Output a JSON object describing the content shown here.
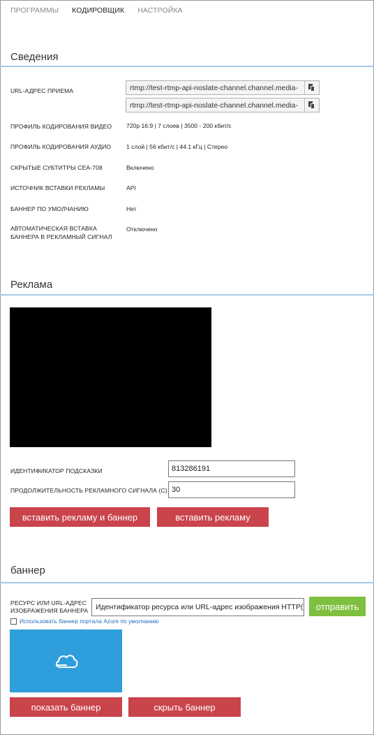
{
  "tabs": [
    {
      "label": "ПРОГРАММЫ",
      "active": false
    },
    {
      "label": "КОДИРОВЩИК",
      "active": true
    },
    {
      "label": "НАСТРОЙКА",
      "active": false
    }
  ],
  "info": {
    "title": "Сведения",
    "ingest_url_label": "URL-АДРЕС ПРИЕМА",
    "ingest_urls": [
      "rtmp://test-rtmp-api-noslate-channel.channel.media-",
      "rtmp://test-rtmp-api-noslate-channel.channel.media-"
    ],
    "video_profile_label": "ПРОФИЛЬ КОДИРОВАНИЯ ВИДЕО",
    "video_profile_value": "720p 16:9 | 7 слоев | 3500 - 200 кбит/с",
    "audio_profile_label": "ПРОФИЛЬ КОДИРОВАНИЯ АУДИО",
    "audio_profile_value": "1 слой | 56 кбит/с | 44.1 кГц | Стерео",
    "captions_label": "СКРЫТЫЕ СУБТИТРЫ CEA-708",
    "captions_value": "Включено",
    "ad_source_label": "ИСТОЧНИК ВСТАВКИ РЕКЛАМЫ",
    "ad_source_value": "API",
    "default_slate_label": "БАННЕР ПО УМОЛЧАНИЮ",
    "default_slate_value": "Нет",
    "auto_slate_label_line1": "АВТОМАТИЧЕСКАЯ ВСТАВКА",
    "auto_slate_label_line2": "БАННЕРА В РЕКЛАМНЫЙ СИГНАЛ",
    "auto_slate_value": "Отключено"
  },
  "ads": {
    "title": "Реклама",
    "cue_id_label": "ИДЕНТИФИКАТОР ПОДСКАЗКИ",
    "cue_id_value": "813286191",
    "duration_label": "ПРОДОЛЖИТЕЛЬНОСТЬ РЕКЛАМНОГО СИГНАЛА (С)",
    "duration_value": "30",
    "insert_ad_and_slate_label": "вставить рекламу и баннер",
    "insert_ad_label": "вставить рекламу"
  },
  "slate": {
    "title": "баннер",
    "resource_label_line1": "РЕСУРС ИЛИ URL-АДРЕС",
    "resource_label_line2": "ИЗОБРАЖЕНИЯ БАННЕРА",
    "resource_placeholder": "Идентификатор ресурса или URL-адрес изображения HTTP(S)",
    "submit_label": "отправить",
    "use_default_label": "Использовать баннер портала Azure по умолчанию",
    "use_default_checked": false,
    "show_label": "показать баннер",
    "hide_label": "скрыть баннер"
  },
  "colors": {
    "accent_line": "#a9c8e6",
    "button_red": "#c9444b",
    "button_green": "#7fbf3f",
    "slate_preview": "#2e9edc"
  },
  "icons": {
    "copy": "copy-icon",
    "cloud": "cloud-icon"
  }
}
